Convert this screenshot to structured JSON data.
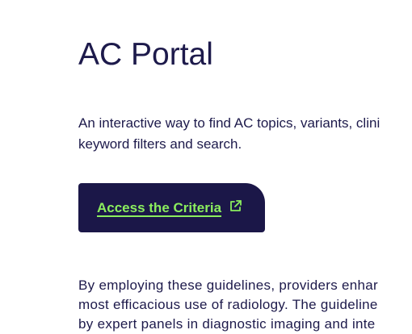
{
  "page": {
    "title": "AC Portal",
    "intro_lines": [
      "An interactive way to find AC topics, variants, clini",
      "keyword filters and search."
    ],
    "cta": {
      "label": "Access the Criteria",
      "icon": "external-link-icon"
    },
    "body_lines": [
      "By employing these guidelines, providers enhar",
      "most efficacious use of radiology. The guideline",
      "by expert panels in diagnostic imaging and inte"
    ]
  },
  "colors": {
    "text": "#1d1a4b",
    "cta_background": "#1b1748",
    "cta_text": "#8bee5e"
  }
}
